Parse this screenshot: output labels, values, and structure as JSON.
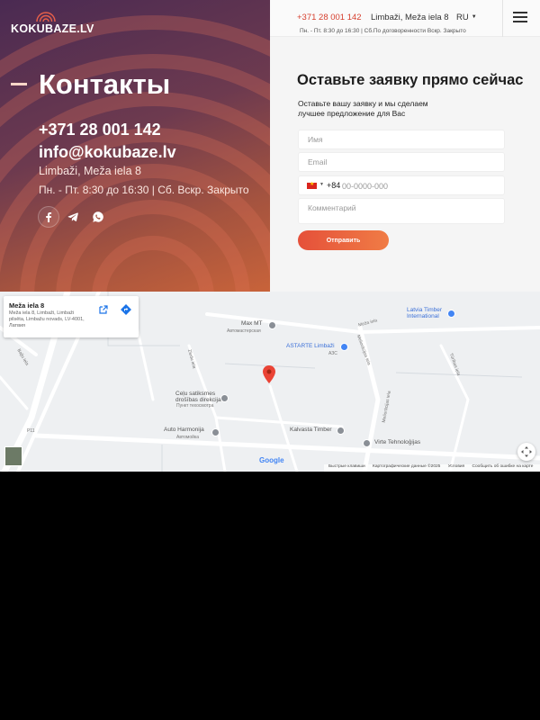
{
  "brand": {
    "name": "KOKUBAZE.LV"
  },
  "header": {
    "phone": "+371 28 001 142",
    "address": "Limbaži, Meža iela 8",
    "language": "RU",
    "hours": "Пн. - Пт. 8:30 до 16:30 | Сб.По договоренности Вскр. Закрыто"
  },
  "hero": {
    "title": "Контакты",
    "phone": "+371 28 001 142",
    "email": "info@kokubaze.lv",
    "address": "Limbaži, Meža iela 8",
    "hours": "Пн. - Пт. 8:30 до 16:30 | Сб. Вскр. Закрыто",
    "social": [
      {
        "icon": "facebook-icon"
      },
      {
        "icon": "telegram-icon"
      },
      {
        "icon": "whatsapp-icon"
      }
    ]
  },
  "form": {
    "title": "Оставьте заявку прямо сейчас",
    "subtitle": "Оставьте вашу заявку и мы сделаем лучшее предложение для Вас",
    "name_placeholder": "Имя",
    "email_placeholder": "Email",
    "dial_code": "+84",
    "phone_placeholder": "00-0000-000",
    "comment_placeholder": "Комментарий",
    "submit_label": "Отправить"
  },
  "map": {
    "card_title": "Meža iela 8",
    "card_address": "Meža iela 8, Limbaži, Limbaži pilsēta, Limbažu novads, LV-4001, Латвия",
    "places": [
      {
        "name": "Max MT",
        "category": "Автомастерская"
      },
      {
        "name": "ASTARTE Limbaži",
        "category": "АЗС"
      },
      {
        "name": "Latvia Timber International",
        "category": ""
      },
      {
        "name": "Ceļu satiksmes drošības direkcija",
        "category": "Пункт техосмотра"
      },
      {
        "name": "Auto Harmonija",
        "category": "Автомойка"
      },
      {
        "name": "Kalvasta Timber",
        "category": ""
      },
      {
        "name": "Virte Tehnoloģijas",
        "category": ""
      }
    ],
    "streets": [
      "Meža iela",
      "Meliorācijas iela",
      "Meliorācijas iela",
      "Tūrības iela",
      "Baļļu iela",
      "Ziedu iela",
      "P11"
    ],
    "google": "Google",
    "attribution": [
      "Быстрые клавиши",
      "Картографические данные ©2025",
      "Условия",
      "Сообщить об ошибке на карте"
    ]
  },
  "colors": {
    "accent": "#e5503a",
    "hero_dark": "#4a2a52",
    "hero_warm": "#c8633a"
  }
}
